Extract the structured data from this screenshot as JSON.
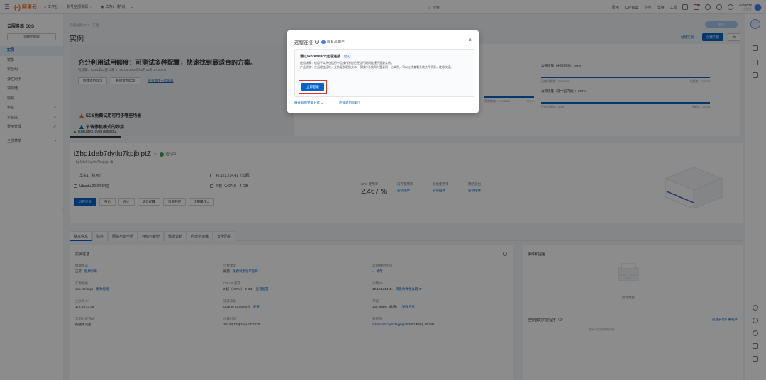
{
  "topbar": {
    "logo": "阿里云",
    "workbench": "工作台",
    "account": "账号全部资源",
    "region": "华东1（杭州）",
    "search_placeholder": "搜索",
    "links": [
      "费用",
      "ICP 备案",
      "企业",
      "支持",
      "工单"
    ],
    "user_name": "bob6072",
    "user_sub": "主账号"
  },
  "sidebar": {
    "title": "云服务器 ECS",
    "switch_label": "切换至新版",
    "items": [
      {
        "label": "实例"
      },
      {
        "label": "镜像"
      },
      {
        "label": "安全组"
      },
      {
        "label": "弹性网卡"
      },
      {
        "label": "块存储"
      },
      {
        "label": "快照"
      },
      {
        "label": "标签"
      },
      {
        "label": "云监控"
      },
      {
        "label": "费用管理"
      }
    ],
    "bottom_item": "全部菜单"
  },
  "header": {
    "breadcrumb": "云服务器 ECS / 实例",
    "title": "实例",
    "pill": "新版",
    "btn_link": "创建实例",
    "btn_line": "购买",
    "btn_primary": "创建实例"
  },
  "promo": {
    "title": "充分利用试用额度：可测试多种配置，快速找到最适合的方案。",
    "date": "有效期：2024年12月15日 17:00:00-2025年01月15日 17:00:00",
    "btn1": "创建试用ECS",
    "btn2": "释放试用ECS",
    "btn3": "查看试用一起说说",
    "line1": "ECS免费试用可用于哪些场景",
    "line2": "节省停机模式的妙用"
  },
  "traffic": [
    {
      "label": "公网流量（中国内地）：99%",
      "left": "已使用额度：0.998GB",
      "right": "总额度：100GB",
      "pct": 99
    },
    {
      "label": "公网流量（非中国内地）：100%",
      "left": "已使用额度：0GB",
      "right": "总额度：20GB",
      "pct": 100
    },
    {
      "label": "",
      "left": "免费额度：0.998GB",
      "right": "100%",
      "pct": 100
    },
    {
      "label": "",
      "left": "免费额度：0GB",
      "right": "20GB",
      "pct": 100
    }
  ],
  "instance": {
    "tab_label": "iZbp1deb7dytlu7kpjbjptZ",
    "name": "iZbp1deb7dytlu7kpjbjptZ",
    "status": "运行中",
    "id": "i-bp1deb7dytlu7kpjbjpt",
    "region": "华东1（杭州）",
    "os": "Ubuntu 22.04 64位",
    "ip": "42.121.214.41（公网）",
    "spec": "2 核（vCPU） 2 GiB",
    "actions": [
      "远程连接",
      "重启",
      "停止",
      "更改配置",
      "资源升配",
      "全部操作"
    ],
    "metrics": [
      {
        "label": "CPU 使用率",
        "value": "2.467 %"
      },
      {
        "label": "内存使用率",
        "link": "安装插件"
      },
      {
        "label": "云盘使用率",
        "link": "安装插件"
      },
      {
        "label": "网络流出",
        "link": "安装插件"
      }
    ]
  },
  "tabs": [
    "基本信息",
    "监控",
    "网络与安全组",
    "存储与备份",
    "健康诊断",
    "自动化运维",
    "安全防护"
  ],
  "details": {
    "title": "实例信息",
    "fields": [
      {
        "label": "健康状态",
        "value": "正常",
        "link": "健康诊断"
      },
      {
        "label": "付费类型",
        "value": "按量",
        "link": "免费试用包年包月"
      },
      {
        "label": "自动释放时间",
        "value": "-",
        "link": "修改"
      },
      {
        "label": "实例规格",
        "value": "ecs.c7t.large",
        "link": "更改规格"
      },
      {
        "label": "CPU & 内存",
        "value": "2 核（vCPU） 2 GiB",
        "link": "查看配置"
      },
      {
        "label": "公网 IP",
        "value": "42.121.214.41",
        "link": "转换为弹性公网 IP"
      },
      {
        "label": "主私网 IP",
        "value": "172.19.43.46",
        "link": ""
      },
      {
        "label": "操作系统",
        "value": "Ubuntu 22.04 64位",
        "link": "更换"
      },
      {
        "label": "带宽",
        "value": "100 Mbps（峰值）",
        "link": "更改带宽"
      },
      {
        "label": "实例计费方式",
        "value": "按使用流量",
        "link": ""
      },
      {
        "label": "创建时间",
        "value": "2024年12月15日 17:24:00",
        "link": ""
      },
      {
        "label": "系统盘",
        "value": "d-bp1deb7dytlu7kpjbgn",
        "link": "ESSD Entry 40 GiB"
      }
    ]
  },
  "events": {
    "title": "事件和提醒",
    "empty_text": "暂无数据",
    "title2": "已安装的扩展程序（0）",
    "link2": "前往安装扩展程序",
    "hint": "暂无可以安装的扩展"
  },
  "modal": {
    "title": "远程连接",
    "ai_label": "阿里 AI 助手",
    "card_title": "通过Workbench远程连接",
    "card_tag": "默认",
    "desc1": "使用场景：适用于实例在运行中且操作系统已经运行期间连接下登录实例。",
    "desc2": "产品优点：在远程连接时，支持复制粘贴文本、多操作系统同时登录同一台实例，可以在线查看系统文件资源，使用快捷。",
    "login_btn": "立即登录",
    "foot_link1": "展开其他登录方式",
    "foot_link2": "连接遇到问题？"
  }
}
